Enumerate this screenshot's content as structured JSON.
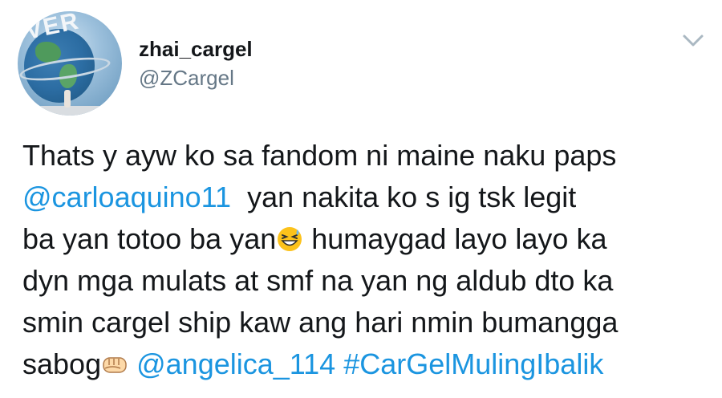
{
  "author": {
    "display_name": "zhai_cargel",
    "handle": "@ZCargel",
    "avatar_logo_text": "VER"
  },
  "menu": {
    "icon": "chevron-down-icon"
  },
  "tweet": {
    "l1": "Thats y ayw ko sa fandom ni maine naku paps",
    "l2_mention": "@carloaquino11",
    "l2_text": "  yan nakita ko s ig tsk legit",
    "l3_a": "ba yan totoo ba yan",
    "l3_emoji": "grinning-squinting-sweat-face-emoji",
    "l3_b": " humaygad layo layo ka",
    "l4": "dyn mga mulats at smf na yan ng aldub dto ka",
    "l5": "smin cargel ship kaw ang hari nmin bumangga",
    "l6_a": "sabog",
    "l6_emoji": "fist-bump-emoji",
    "l6_mention": "@angelica_114",
    "l6_hashtag": "#CarGelMulingIbalik"
  },
  "colors": {
    "link": "#1b95e0",
    "text": "#14171a",
    "muted": "#657786"
  }
}
